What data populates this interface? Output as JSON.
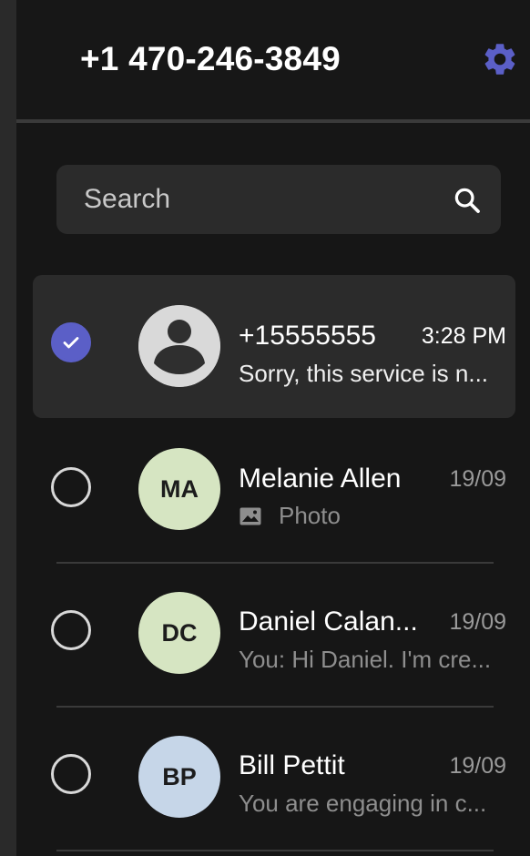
{
  "header": {
    "phone_number": "+1 470-246-3849",
    "settings_icon": "gear-icon",
    "accent_color": "#5b5fc7"
  },
  "search": {
    "placeholder": "Search",
    "value": "",
    "icon": "search-icon"
  },
  "conversations": [
    {
      "selected": true,
      "avatar_type": "person-placeholder-icon",
      "name": "+15555555",
      "time": "3:28 PM",
      "preview": "Sorry, this service is n..."
    },
    {
      "selected": false,
      "initials": "MA",
      "avatar_color": "#d6e5c2",
      "name": "Melanie Allen",
      "time": "19/09",
      "preview_icon": "photo-icon",
      "preview": "Photo"
    },
    {
      "selected": false,
      "initials": "DC",
      "avatar_color": "#d6e5c2",
      "name": "Daniel Calan...",
      "time": "19/09",
      "preview": "You: Hi Daniel. I'm cre..."
    },
    {
      "selected": false,
      "initials": "BP",
      "avatar_color": "#c6d6e8",
      "name": "Bill Pettit",
      "time": "19/09",
      "preview": "You are engaging in c..."
    }
  ]
}
